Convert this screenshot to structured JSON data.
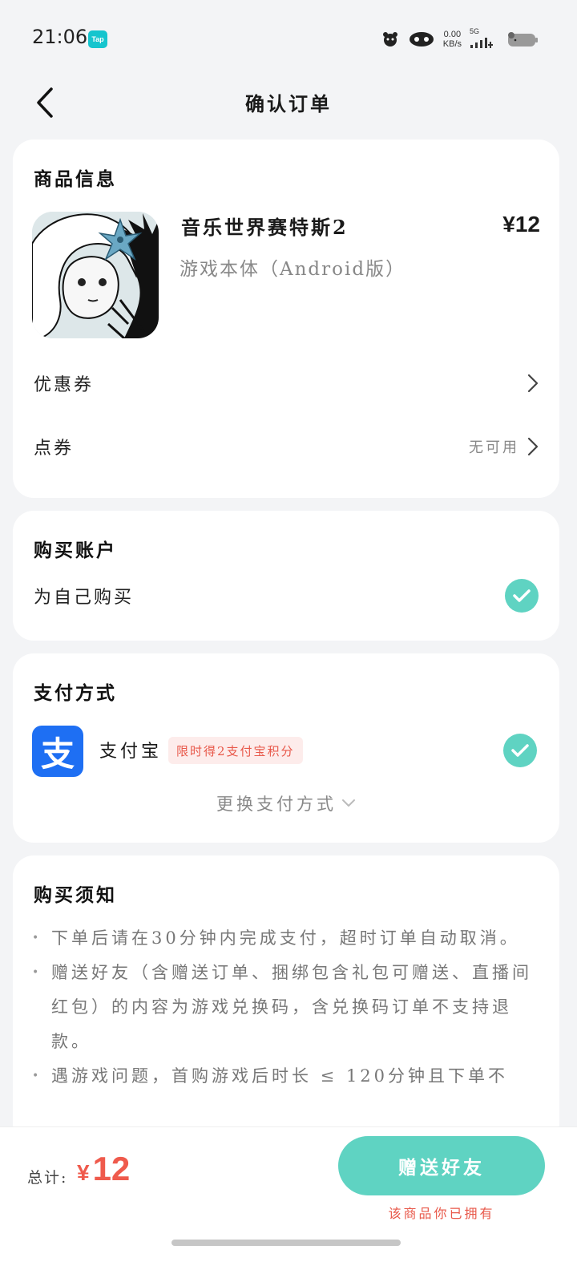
{
  "status_bar": {
    "time": "21:06",
    "tap_badge": "Tap",
    "net_speed_value": "0.00",
    "net_speed_unit": "KB/s",
    "network": "5G"
  },
  "nav": {
    "title": "确认订单"
  },
  "product": {
    "section_title": "商品信息",
    "game_name": "音乐世界赛特斯2",
    "edition": "游戏本体（Android版）",
    "price": "¥12",
    "coupon_label": "优惠券",
    "points_label": "点券",
    "points_value": "无可用"
  },
  "account": {
    "section_title": "购买账户",
    "option_label": "为自己购买",
    "selected": true
  },
  "payment": {
    "section_title": "支付方式",
    "method_name": "支付宝",
    "logo_glyph": "支",
    "promo_tag": "限时得2支付宝积分",
    "change_label": "更换支付方式",
    "selected": true
  },
  "notice": {
    "section_title": "购买须知",
    "items": [
      "下单后请在30分钟内完成支付，超时订单自动取消。",
      "赠送好友（含赠送订单、捆绑包含礼包可赠送、直播间红包）的内容为游戏兑换码，含兑换码订单不支持退款。",
      "遇游戏问题，首购游戏后时长 ≤ 120分钟且下单不"
    ]
  },
  "footer": {
    "total_label": "总计:",
    "currency": "¥",
    "total_amount": "12",
    "gift_button": "赠送好友",
    "owned_note": "该商品你已拥有"
  },
  "colors": {
    "accent": "#5fd3c2",
    "price_red": "#ef5a4c",
    "alipay_blue": "#1e6ff3",
    "tap_cyan": "#15c5ce"
  },
  "icons": [
    "back-arrow-icon",
    "chevron-right-icon",
    "check-icon",
    "chevron-down-icon",
    "signal-icon",
    "battery-icon"
  ]
}
